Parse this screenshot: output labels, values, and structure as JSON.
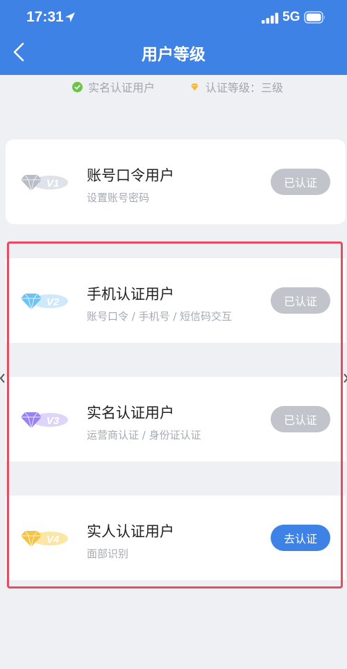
{
  "status_bar": {
    "time": "17:31",
    "network": "5G",
    "icons": [
      "location-arrow-icon",
      "signal-bars-icon",
      "battery-icon"
    ]
  },
  "nav": {
    "back_icon": "chevron-left-icon",
    "title": "用户等级"
  },
  "summary": {
    "verified_label": "实名认证用户",
    "level_label": "认证等级：三级",
    "verified_color": "#6cc24a",
    "level_color": "#f5b83d"
  },
  "levels": [
    {
      "badge": "V1",
      "badge_color": "#b7bcc6",
      "title": "账号口令用户",
      "subtitle": "设置账号密码",
      "button": "已认证",
      "state": "done"
    },
    {
      "badge": "V2",
      "badge_color": "#6ec3f6",
      "title": "手机认证用户",
      "subtitle": "账号口令 / 手机号 / 短信码交互",
      "button": "已认证",
      "state": "done"
    },
    {
      "badge": "V3",
      "badge_color": "#9a83ee",
      "title": "实名认证用户",
      "subtitle": "运营商认证 / 身份证认证",
      "button": "已认证",
      "state": "done"
    },
    {
      "badge": "V4",
      "badge_color": "#f5c443",
      "title": "实人认证用户",
      "subtitle": "面部识别",
      "button": "去认证",
      "state": "action"
    }
  ],
  "colors": {
    "primary": "#3e82e6",
    "done_button": "#c1c4ca",
    "highlight": "#e94a5f",
    "background": "#eef0f3"
  }
}
